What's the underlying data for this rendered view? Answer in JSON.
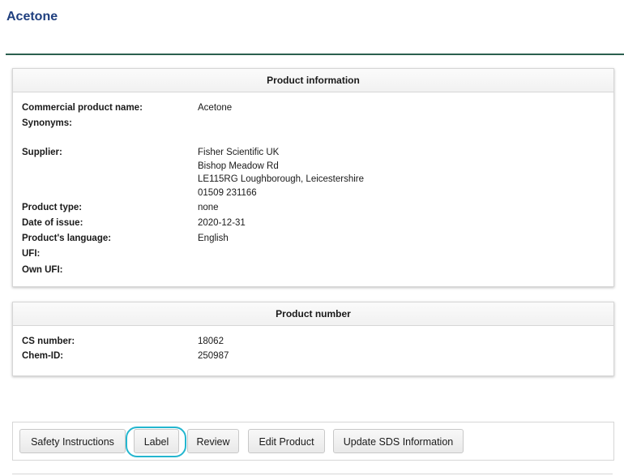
{
  "page": {
    "title": "Acetone"
  },
  "product_info": {
    "header": "Product information",
    "commercial_name": {
      "label": "Commercial product name:",
      "value": "Acetone"
    },
    "synonyms": {
      "label": "Synonyms:",
      "value": ""
    },
    "supplier": {
      "label": "Supplier:",
      "lines": [
        "Fisher Scientific UK",
        "Bishop Meadow Rd",
        "LE115RG Loughborough, Leicestershire",
        "01509 231166"
      ]
    },
    "product_type": {
      "label": "Product type:",
      "value": "none"
    },
    "date_of_issue": {
      "label": "Date of issue:",
      "value": "2020-12-31"
    },
    "language": {
      "label": "Product's language:",
      "value": "English"
    },
    "ufi": {
      "label": "UFI:",
      "value": ""
    },
    "own_ufi": {
      "label": "Own UFI:",
      "value": ""
    }
  },
  "product_number": {
    "header": "Product number",
    "cs_number": {
      "label": "CS number:",
      "value": "18062"
    },
    "chem_id": {
      "label": "Chem-ID:",
      "value": "250987"
    }
  },
  "buttons": {
    "safety_instructions": "Safety Instructions",
    "label": "Label",
    "review": "Review",
    "edit_product": "Edit Product",
    "update_sds": "Update SDS Information"
  },
  "colors": {
    "title": "#1f3f7f",
    "rule": "#2b5f4f",
    "highlight": "#24b6cf"
  }
}
